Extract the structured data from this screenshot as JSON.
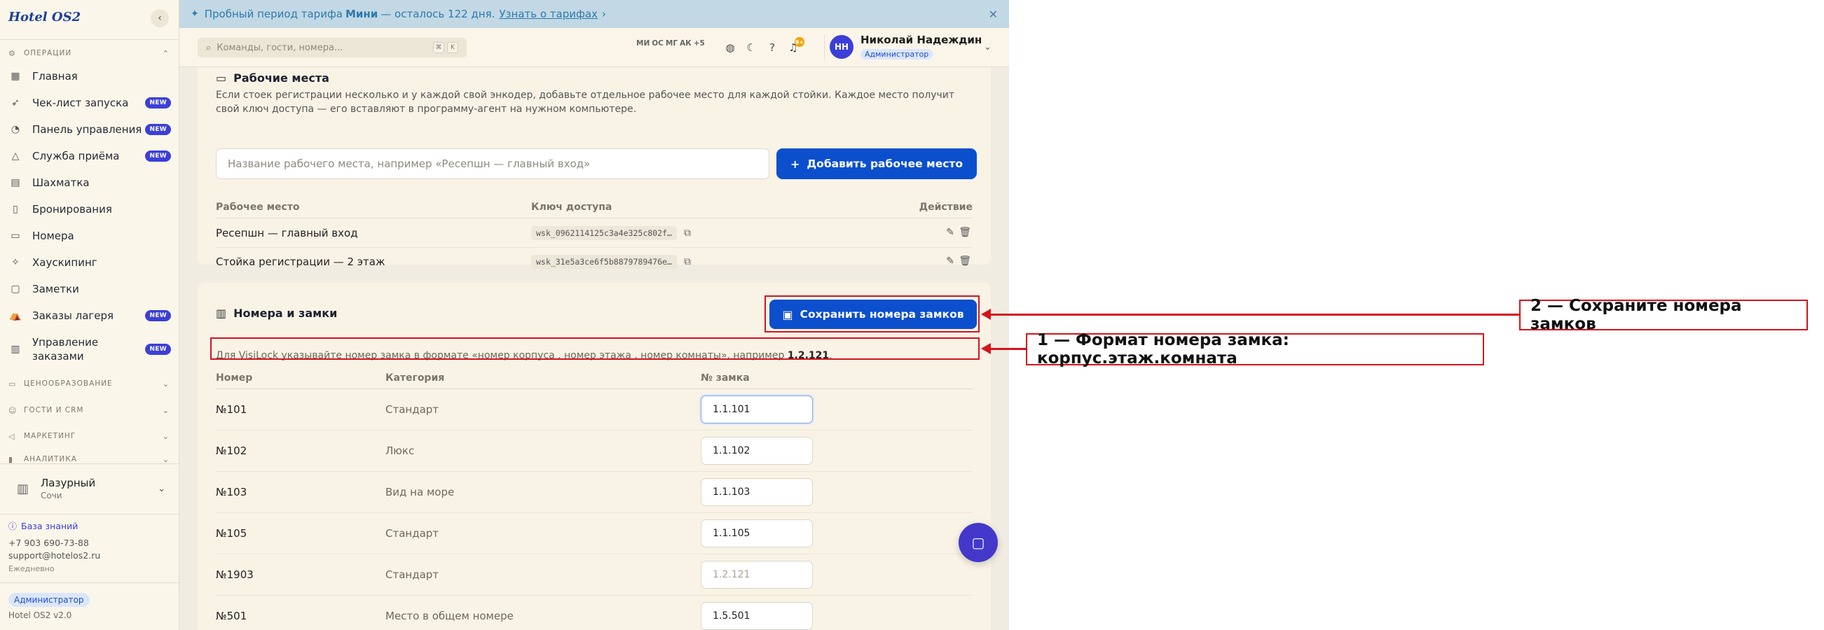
{
  "app": {
    "logo": "Hotel OS2"
  },
  "banner": {
    "text_before": "Пробный период тарифа",
    "plan": "Мини",
    "text_after": "— осталось 122 дня.",
    "link": "Узнать о тарифах",
    "link_chevron": "›"
  },
  "search": {
    "placeholder": "Команды, гости, номера...",
    "kbd1": "⌘",
    "kbd2": "K"
  },
  "presence": [
    "МИ",
    "ОС",
    "МГ",
    "АК",
    "+5"
  ],
  "notifications": {
    "count": "9+"
  },
  "user": {
    "initials": "НН",
    "name": "Николай Надеждин",
    "role": "Администратор"
  },
  "sidebar": {
    "groups": {
      "operations": "ОПЕРАЦИИ",
      "pricing": "ЦЕНООБРАЗОВАНИЕ",
      "guests": "ГОСТИ И CRM",
      "marketing": "МАРКЕТИНГ",
      "analytics": "АНАЛИТИКА"
    },
    "items": [
      {
        "label": "Главная",
        "icon": "grid-icon"
      },
      {
        "label": "Чек-лист запуска",
        "icon": "rocket-icon",
        "badge": "NEW"
      },
      {
        "label": "Панель управления",
        "icon": "gauge-icon",
        "badge": "NEW"
      },
      {
        "label": "Служба приёма",
        "icon": "bell-icon",
        "badge": "NEW"
      },
      {
        "label": "Шахматка",
        "icon": "table-icon"
      },
      {
        "label": "Бронирования",
        "icon": "clipboard-icon"
      },
      {
        "label": "Номера",
        "icon": "door-icon"
      },
      {
        "label": "Хаускипинг",
        "icon": "sparkle-icon"
      },
      {
        "label": "Заметки",
        "icon": "note-icon"
      },
      {
        "label": "Заказы лагеря",
        "icon": "tent-icon",
        "badge": "NEW"
      },
      {
        "label": "Управление заказами",
        "icon": "receipt-icon",
        "badge": "NEW"
      }
    ],
    "hotel": {
      "name": "Лазурный",
      "city": "Сочи"
    },
    "knowledge_base": "База знаний",
    "phone": "+7 903 690-73-88",
    "email": "support@hotelos2.ru",
    "availability": "Ежедневно",
    "role": "Администратор",
    "version": "Hotel OS2 v2.0"
  },
  "workstations": {
    "title": "Рабочие места",
    "description": "Если стоек регистрации несколько и у каждой свой энкодер, добавьте отдельное рабочее место для каждой стойки. Каждое место получит свой ключ доступа — его вставляют в программу-агент на нужном компьютере.",
    "input_placeholder": "Название рабочего места, например «Ресепшн — главный вход»",
    "add_button": "Добавить рабочее место",
    "columns": {
      "place": "Рабочее место",
      "key": "Ключ доступа",
      "action": "Действие"
    },
    "rows": [
      {
        "name": "Ресепшн — главный вход",
        "key": "wsk_0962114125c3a4e325c802f…"
      },
      {
        "name": "Стойка регистрации — 2 этаж",
        "key": "wsk_31e5a3ce6f5b8879789476e…"
      }
    ]
  },
  "rooms": {
    "title": "Номера и замки",
    "save_button": "Сохранить номера замков",
    "note_text": "Для VisiLock указывайте номер замка в формате «номер корпуса . номер этажа . номер комнаты», например",
    "note_example": "1.2.121",
    "note_end": ".",
    "columns": {
      "number": "Номер",
      "category": "Категория",
      "lock": "№ замка"
    },
    "rows": [
      {
        "number": "№101",
        "category": "Стандарт",
        "lock": "1.1.101"
      },
      {
        "number": "№102",
        "category": "Люкс",
        "lock": "1.1.102"
      },
      {
        "number": "№103",
        "category": "Вид на море",
        "lock": "1.1.103"
      },
      {
        "number": "№105",
        "category": "Стандарт",
        "lock": "1.1.105"
      },
      {
        "number": "№1903",
        "category": "Стандарт",
        "lock": "",
        "placeholder": "1.2.121"
      },
      {
        "number": "№501",
        "category": "Место в общем номере",
        "lock": "1.5.501"
      }
    ]
  },
  "annotations": {
    "step1": "1 — Формат номера замка: корпус.этаж.комната",
    "step2": "2 — Сохраните номера замков",
    "color": "#d4141b"
  }
}
